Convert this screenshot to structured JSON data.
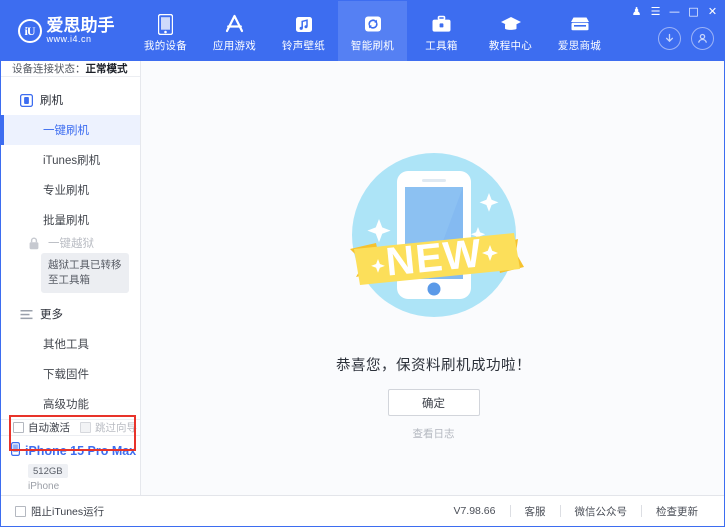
{
  "window": {
    "controls": [
      {
        "name": "skin-icon",
        "glyph": "♟"
      },
      {
        "name": "menu-icon",
        "glyph": "☰"
      },
      {
        "name": "minimize-icon",
        "glyph": "—"
      },
      {
        "name": "maximize-icon",
        "glyph": "□"
      },
      {
        "name": "close-icon",
        "glyph": "✕"
      }
    ]
  },
  "header": {
    "logo_cn": "爱思助手",
    "logo_url": "www.i4.cn",
    "logo_mark": "iU",
    "accent": "#3d6df0",
    "active_tab_bg": "#5580f3",
    "tabs": [
      {
        "label": "我的设备",
        "icon": "phone-icon",
        "active": false
      },
      {
        "label": "应用游戏",
        "icon": "appstore-icon",
        "active": false
      },
      {
        "label": "铃声壁纸",
        "icon": "music-icon",
        "active": false
      },
      {
        "label": "智能刷机",
        "icon": "refresh-icon",
        "active": true
      },
      {
        "label": "工具箱",
        "icon": "toolbox-icon",
        "active": false
      },
      {
        "label": "教程中心",
        "icon": "graduation-cap-icon",
        "active": false
      },
      {
        "label": "爱思商城",
        "icon": "store-icon",
        "active": false
      }
    ],
    "actions": [
      {
        "name": "download-icon",
        "glyph": "↓"
      },
      {
        "name": "user-account-icon",
        "glyph": "●"
      }
    ]
  },
  "sidebar": {
    "status_label": "设备连接状态：",
    "status_value": "正常模式",
    "group_flash": {
      "title": "刷机",
      "icon": "flash-device-icon",
      "items": [
        {
          "label": "一键刷机",
          "selected": true,
          "disabled": false
        },
        {
          "label": "iTunes刷机",
          "selected": false,
          "disabled": false
        },
        {
          "label": "专业刷机",
          "selected": false,
          "disabled": false
        },
        {
          "label": "批量刷机",
          "selected": false,
          "disabled": false
        }
      ]
    },
    "jailbreak": {
      "label": "一键越狱",
      "icon": "lock-icon",
      "disabled": true,
      "tooltip": "越狱工具已转移至工具箱"
    },
    "group_more": {
      "title": "更多",
      "icon": "list-icon",
      "items": [
        {
          "label": "其他工具",
          "selected": false,
          "disabled": false
        },
        {
          "label": "下载固件",
          "selected": false,
          "disabled": false
        },
        {
          "label": "高级功能",
          "selected": false,
          "disabled": false
        }
      ]
    },
    "options": [
      {
        "label": "自动激活",
        "checked": false,
        "disabled": false
      },
      {
        "label": "跳过向导",
        "checked": false,
        "disabled": true
      }
    ],
    "highlight_color": "#e8332a",
    "device": {
      "name": "iPhone 15 Pro Max",
      "capacity": "512GB",
      "type": "iPhone",
      "icon": "phone-small-icon"
    }
  },
  "main": {
    "illustration": {
      "name": "new-phone-badge-illustration",
      "ribbon_text": "NEW",
      "circle_color": "#ade4f7",
      "ribbon_color": "#fcdf5a",
      "ribbon_shadow": "#f6c22e",
      "phone_screen_color": "#7db4f0"
    },
    "success_message": "恭喜您，保资料刷机成功啦！",
    "confirm_button": "确定",
    "log_link": "查看日志"
  },
  "footer": {
    "block_itunes": {
      "label": "阻止iTunes运行",
      "checked": false
    },
    "version": "V7.98.66",
    "links": [
      {
        "label": "客服"
      },
      {
        "label": "微信公众号"
      },
      {
        "label": "检查更新"
      }
    ]
  }
}
